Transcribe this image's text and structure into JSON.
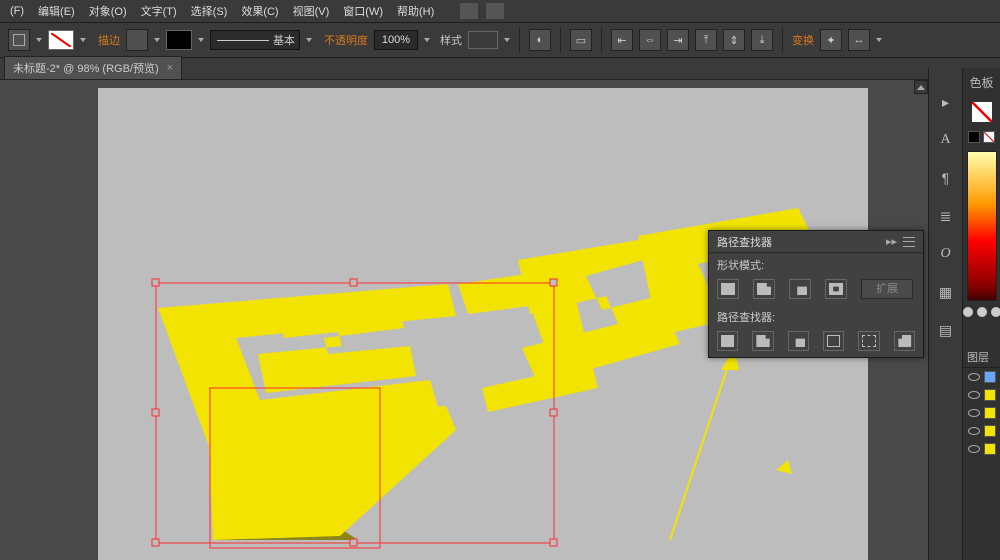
{
  "menus": {
    "file": "(F)",
    "edit": "编辑(E)",
    "object": "对象(O)",
    "type": "文字(T)",
    "select": "选择(S)",
    "effect": "效果(C)",
    "view": "视图(V)",
    "window": "窗口(W)",
    "help": "帮助(H)"
  },
  "control": {
    "stroke_label": "描边",
    "brush_label": "基本",
    "opacity_label": "不透明度",
    "opacity_value": "100%",
    "style_label": "样式",
    "transform_label": "变换"
  },
  "doc_tab": "未标题-2* @ 98% (RGB/预览)",
  "pathfinder": {
    "panel_title": "路径查找器",
    "shape_mode": "形状模式:",
    "expand": "扩展",
    "pathfinders": "路径查找器:"
  },
  "right": {
    "color_tab": "色板",
    "layers_tab": "图层"
  }
}
